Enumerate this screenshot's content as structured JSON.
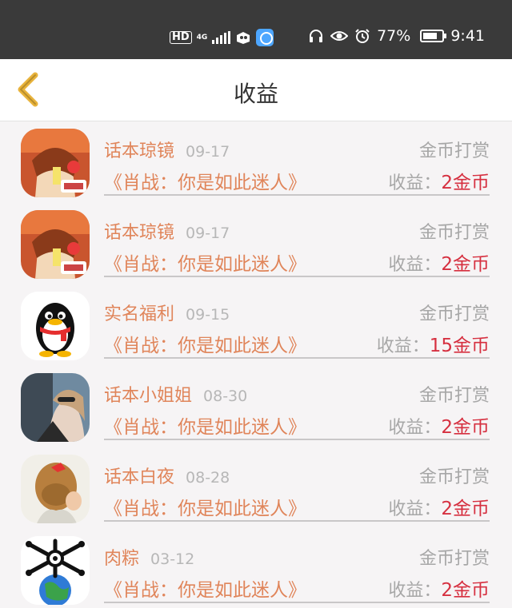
{
  "status_bar": {
    "hd": "HD",
    "network": "4G",
    "battery_text": "77%",
    "battery_level": 0.77,
    "time": "9:41",
    "icons": [
      "headphones-icon",
      "eye-icon",
      "alarm-icon",
      "battery-icon"
    ]
  },
  "header": {
    "title": "收益",
    "back_icon": "chevron-left-icon"
  },
  "colors": {
    "accent": "#e0855a",
    "amount": "#d63040",
    "back_icon": "#e8b33c",
    "status_bar_bg": "#3a3a3a"
  },
  "items": [
    {
      "name": "话本琼镜",
      "date": "09-17",
      "tag": "金币打赏",
      "book": "《肖战：你是如此迷人》",
      "income_label": "收益：",
      "amount": "2金币",
      "avatar": "anime-avatar"
    },
    {
      "name": "话本琼镜",
      "date": "09-17",
      "tag": "金币打赏",
      "book": "《肖战：你是如此迷人》",
      "income_label": "收益：",
      "amount": "2金币",
      "avatar": "anime-avatar"
    },
    {
      "name": "实名福利",
      "date": "09-15",
      "tag": "金币打赏",
      "book": "《肖战：你是如此迷人》",
      "income_label": "收益：",
      "amount": "15金币",
      "avatar": "penguin-avatar"
    },
    {
      "name": "话本小姐姐",
      "date": "08-30",
      "tag": "金币打赏",
      "book": "《肖战：你是如此迷人》",
      "income_label": "收益：",
      "amount": "2金币",
      "avatar": "photo-avatar"
    },
    {
      "name": "话本白夜",
      "date": "08-28",
      "tag": "金币打赏",
      "book": "《肖战：你是如此迷人》",
      "income_label": "收益：",
      "amount": "2金币",
      "avatar": "hair-avatar"
    },
    {
      "name": "肉粽",
      "date": "03-12",
      "tag": "金币打赏",
      "book": "《肖战：你是如此迷人》",
      "income_label": "收益：",
      "amount": "2金币",
      "avatar": "globe-avatar"
    }
  ]
}
